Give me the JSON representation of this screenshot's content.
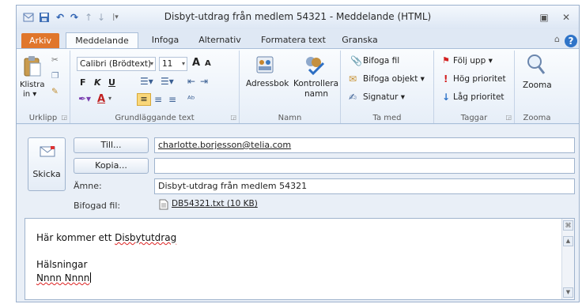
{
  "window": {
    "title": "Disbyt-utdrag från medlem 54321 - Meddelande (HTML)"
  },
  "tabs": [
    {
      "label": "Arkiv"
    },
    {
      "label": "Meddelande"
    },
    {
      "label": "Infoga"
    },
    {
      "label": "Alternativ"
    },
    {
      "label": "Formatera text"
    },
    {
      "label": "Granska"
    }
  ],
  "ribbon": {
    "clipboard": {
      "paste_label": "Klistra",
      "paste_sub": "in ▾",
      "group_label": "Urklipp"
    },
    "basic_text": {
      "font_name": "Calibri (Brödtext)",
      "font_size": "11",
      "grow_font": "A",
      "shrink_font": "A",
      "bold": "F",
      "italic": "K",
      "underline": "U",
      "font_color_letter": "A",
      "group_label": "Grundläggande text"
    },
    "names": {
      "address_book": "Adressbok",
      "check_names_line1": "Kontrollera",
      "check_names_line2": "namn",
      "group_label": "Namn"
    },
    "include": {
      "attach_file": "Bifoga fil",
      "attach_item": "Bifoga objekt ▾",
      "signature": "Signatur ▾",
      "group_label": "Ta med"
    },
    "tags": {
      "follow_up": "Följ upp ▾",
      "high_priority": "Hög prioritet",
      "low_priority": "Låg prioritet",
      "group_label": "Taggar"
    },
    "zoom": {
      "zoom_label": "Zooma",
      "group_label": "Zooma"
    }
  },
  "compose": {
    "send_label": "Skicka",
    "to_button": "Till...",
    "cc_button": "Kopia...",
    "subject_label": "Ämne:",
    "attached_label": "Bifogad fil:",
    "to_value": "charlotte.borjesson@telia.com",
    "cc_value": "",
    "subject_value": "Disbyt-utdrag från medlem 54321",
    "attachment": "DB54321.txt (10 KB)",
    "body": {
      "line1_prefix": "Här kommer ett ",
      "line1_word": "Disbytutdrag",
      "line3": "Hälsningar",
      "line4": "Nnnn Nnnn"
    }
  },
  "colors": {
    "file_tab": "#e0762b",
    "accent": "#2f74c8",
    "high_priority": "#d32020",
    "low_priority": "#2f74c8"
  }
}
